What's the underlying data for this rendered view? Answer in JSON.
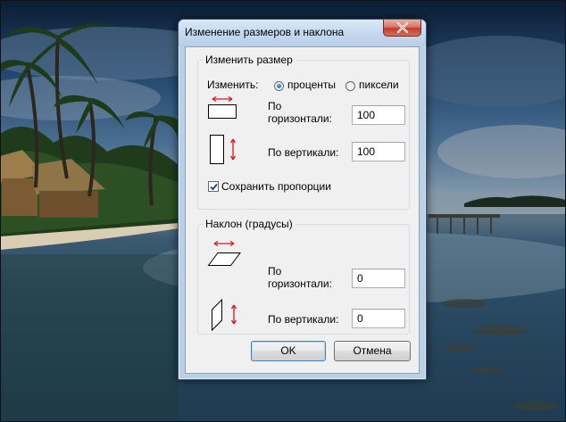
{
  "window": {
    "title": "Изменение размеров и наклона"
  },
  "resize": {
    "group_title": "Изменить размер",
    "by_label": "Изменить:",
    "option_percent": "проценты",
    "option_pixels": "пиксели",
    "selected": "проценты",
    "horizontal_label_line1": "По",
    "horizontal_label_line2": "горизонтали:",
    "horizontal_value": "100",
    "vertical_label": "По вертикали:",
    "vertical_value": "100",
    "keep_ratio_label": "Сохранить пропорции",
    "keep_ratio_checked": true
  },
  "skew": {
    "group_title": "Наклон (градусы)",
    "horizontal_label_line1": "По",
    "horizontal_label_line2": "горизонтали:",
    "horizontal_value": "0",
    "vertical_label": "По вертикали:",
    "vertical_value": "0"
  },
  "buttons": {
    "ok": "OK",
    "cancel": "Отмена"
  },
  "icons": {
    "close": "close-icon",
    "resize_horizontal": "resize-horizontal-icon",
    "resize_vertical": "resize-vertical-icon",
    "skew_horizontal": "skew-horizontal-icon",
    "skew_vertical": "skew-vertical-icon",
    "arrow_color": "#d21a1a"
  }
}
